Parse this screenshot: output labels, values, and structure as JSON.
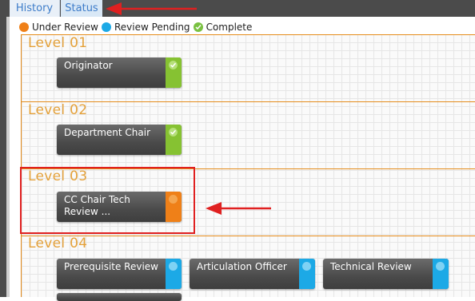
{
  "tabs": [
    {
      "label": "History"
    },
    {
      "label": "Status"
    }
  ],
  "legend": {
    "under_review": "Under Review",
    "review_pending": "Review Pending",
    "complete": "Complete"
  },
  "colors": {
    "under_review": "#ef8018",
    "review_pending": "#1ca9e6",
    "complete": "#86c232",
    "level_accent": "#e48b1a",
    "annotation_red": "#e02020"
  },
  "levels": [
    {
      "label": "Level 01",
      "cards": [
        {
          "label": "Originator",
          "status": "complete"
        }
      ]
    },
    {
      "label": "Level 02",
      "cards": [
        {
          "label": "Department Chair",
          "status": "complete"
        }
      ]
    },
    {
      "label": "Level 03",
      "cards": [
        {
          "label": "CC Chair Tech Review ...",
          "status": "under_review"
        }
      ]
    },
    {
      "label": "Level 04",
      "cards": [
        {
          "label": "Prerequisite Review",
          "status": "review_pending"
        },
        {
          "label": "Articulation Officer",
          "status": "review_pending"
        },
        {
          "label": "Technical Review",
          "status": "review_pending"
        }
      ]
    }
  ]
}
